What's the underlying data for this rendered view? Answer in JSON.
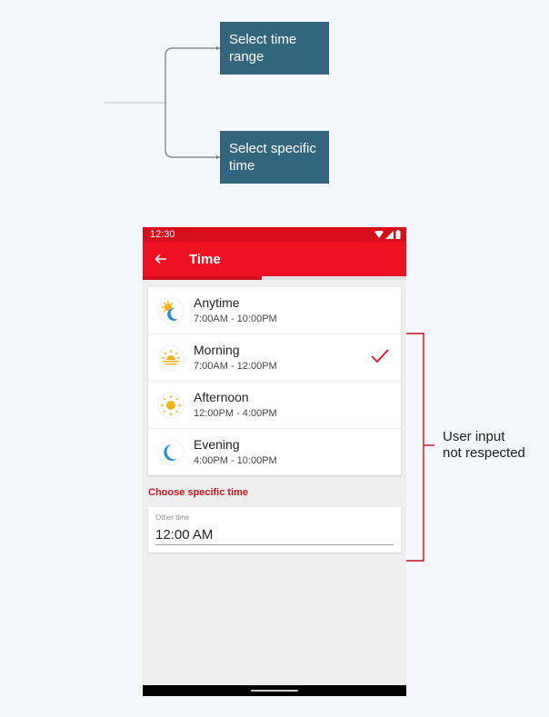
{
  "flow": {
    "box_range": "Select time range",
    "box_specific": "Select specific time"
  },
  "annotation": {
    "text_line1": "User input",
    "text_line2": "not respected",
    "bracket_color": "#d0121f"
  },
  "phone": {
    "status": {
      "time": "12:30"
    },
    "app_bar": {
      "title": "Time",
      "back_icon": "arrow-left-icon"
    },
    "progress": {
      "fraction": 0.45
    },
    "options": [
      {
        "name": "Anytime",
        "time": "7:00AM - 10:00PM",
        "icon": "sun-moon-icon",
        "selected": false
      },
      {
        "name": "Morning",
        "time": "7:00AM - 12:00PM",
        "icon": "sunrise-icon",
        "selected": true
      },
      {
        "name": "Afternoon",
        "time": "12:00PM - 4:00PM",
        "icon": "sun-icon",
        "selected": false
      },
      {
        "name": "Evening",
        "time": "4:00PM - 10:00PM",
        "icon": "moon-icon",
        "selected": false
      }
    ],
    "specific_section": {
      "label": "Choose specific time",
      "field_label": "Other time",
      "field_value": "12:00 AM"
    },
    "colors": {
      "status_bar": "#d70f1c",
      "app_bar": "#ee1122",
      "accent": "#d2121f",
      "sun": "#f5b21b",
      "moon": "#1e8fd1"
    }
  }
}
